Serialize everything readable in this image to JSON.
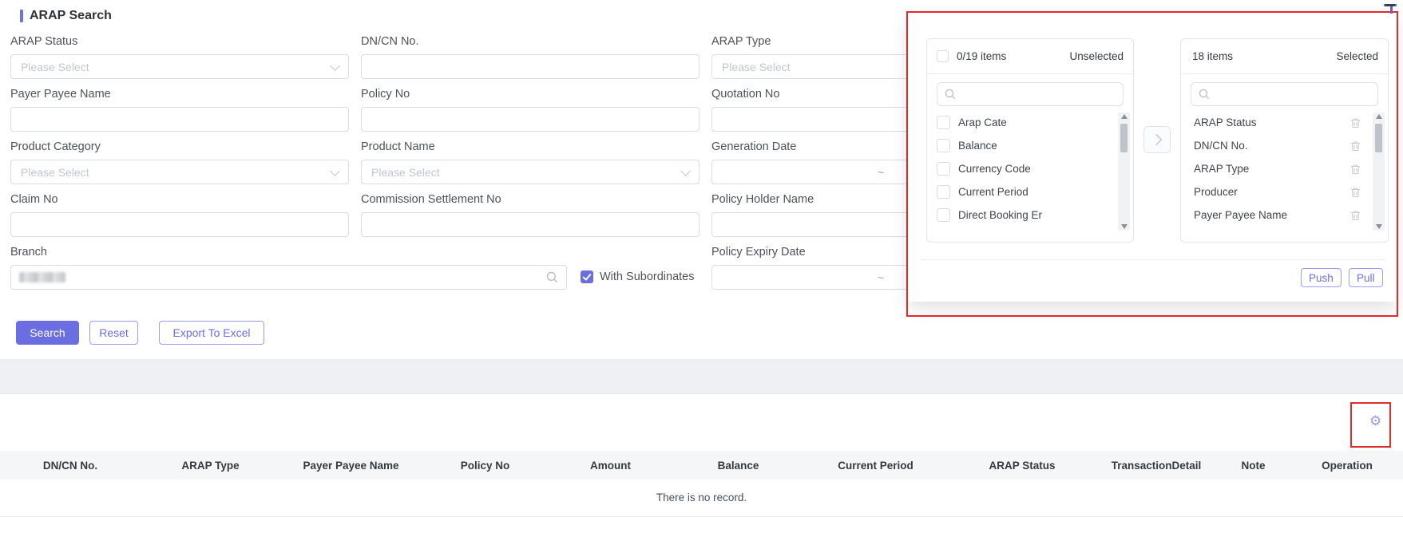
{
  "title": "ARAP Search",
  "form": {
    "fields": {
      "arap_status": {
        "label": "ARAP Status",
        "placeholder": "Please Select"
      },
      "dncn_no": {
        "label": "DN/CN No."
      },
      "arap_type": {
        "label": "ARAP Type",
        "placeholder": "Please Select"
      },
      "payer_payee_name": {
        "label": "Payer Payee Name"
      },
      "policy_no": {
        "label": "Policy No"
      },
      "quotation_no": {
        "label": "Quotation No"
      },
      "product_category": {
        "label": "Product Category",
        "placeholder": "Please Select"
      },
      "product_name": {
        "label": "Product Name",
        "placeholder": "Please Select"
      },
      "generation_date": {
        "label": "Generation Date",
        "separator": "~"
      },
      "claim_no": {
        "label": "Claim No"
      },
      "commission_settlement_no": {
        "label": "Commission Settlement No"
      },
      "policy_holder_name": {
        "label": "Policy Holder Name"
      },
      "branch": {
        "label": "Branch",
        "value_redacted": true
      },
      "policy_expiry_date": {
        "label": "Policy Expiry Date",
        "separator": "~"
      }
    },
    "with_subordinates": {
      "label": "With Subordinates",
      "checked": true
    },
    "actions": {
      "search": "Search",
      "reset": "Reset",
      "export": "Export To Excel"
    }
  },
  "transfer_panel": {
    "unselected": {
      "count": "0/19 items",
      "header": "Unselected",
      "items": [
        "Arap Cate",
        "Balance",
        "Currency Code",
        "Current Period",
        "Direct Booking Er"
      ]
    },
    "selected": {
      "count": "18 items",
      "header": "Selected",
      "items": [
        "ARAP Status",
        "DN/CN No.",
        "ARAP Type",
        "Producer",
        "Payer Payee Name"
      ]
    },
    "actions": {
      "push": "Push",
      "pull": "Pull"
    }
  },
  "table": {
    "columns": [
      "DN/CN No.",
      "ARAP Type",
      "Payer Payee Name",
      "Policy No",
      "Amount",
      "Balance",
      "Current Period",
      "ARAP Status",
      "TransactionDetail",
      "Note",
      "Operation"
    ],
    "empty_message": "There is no record."
  },
  "colors": {
    "accent": "#6a6ee0",
    "annotation": "#e12b2b"
  }
}
